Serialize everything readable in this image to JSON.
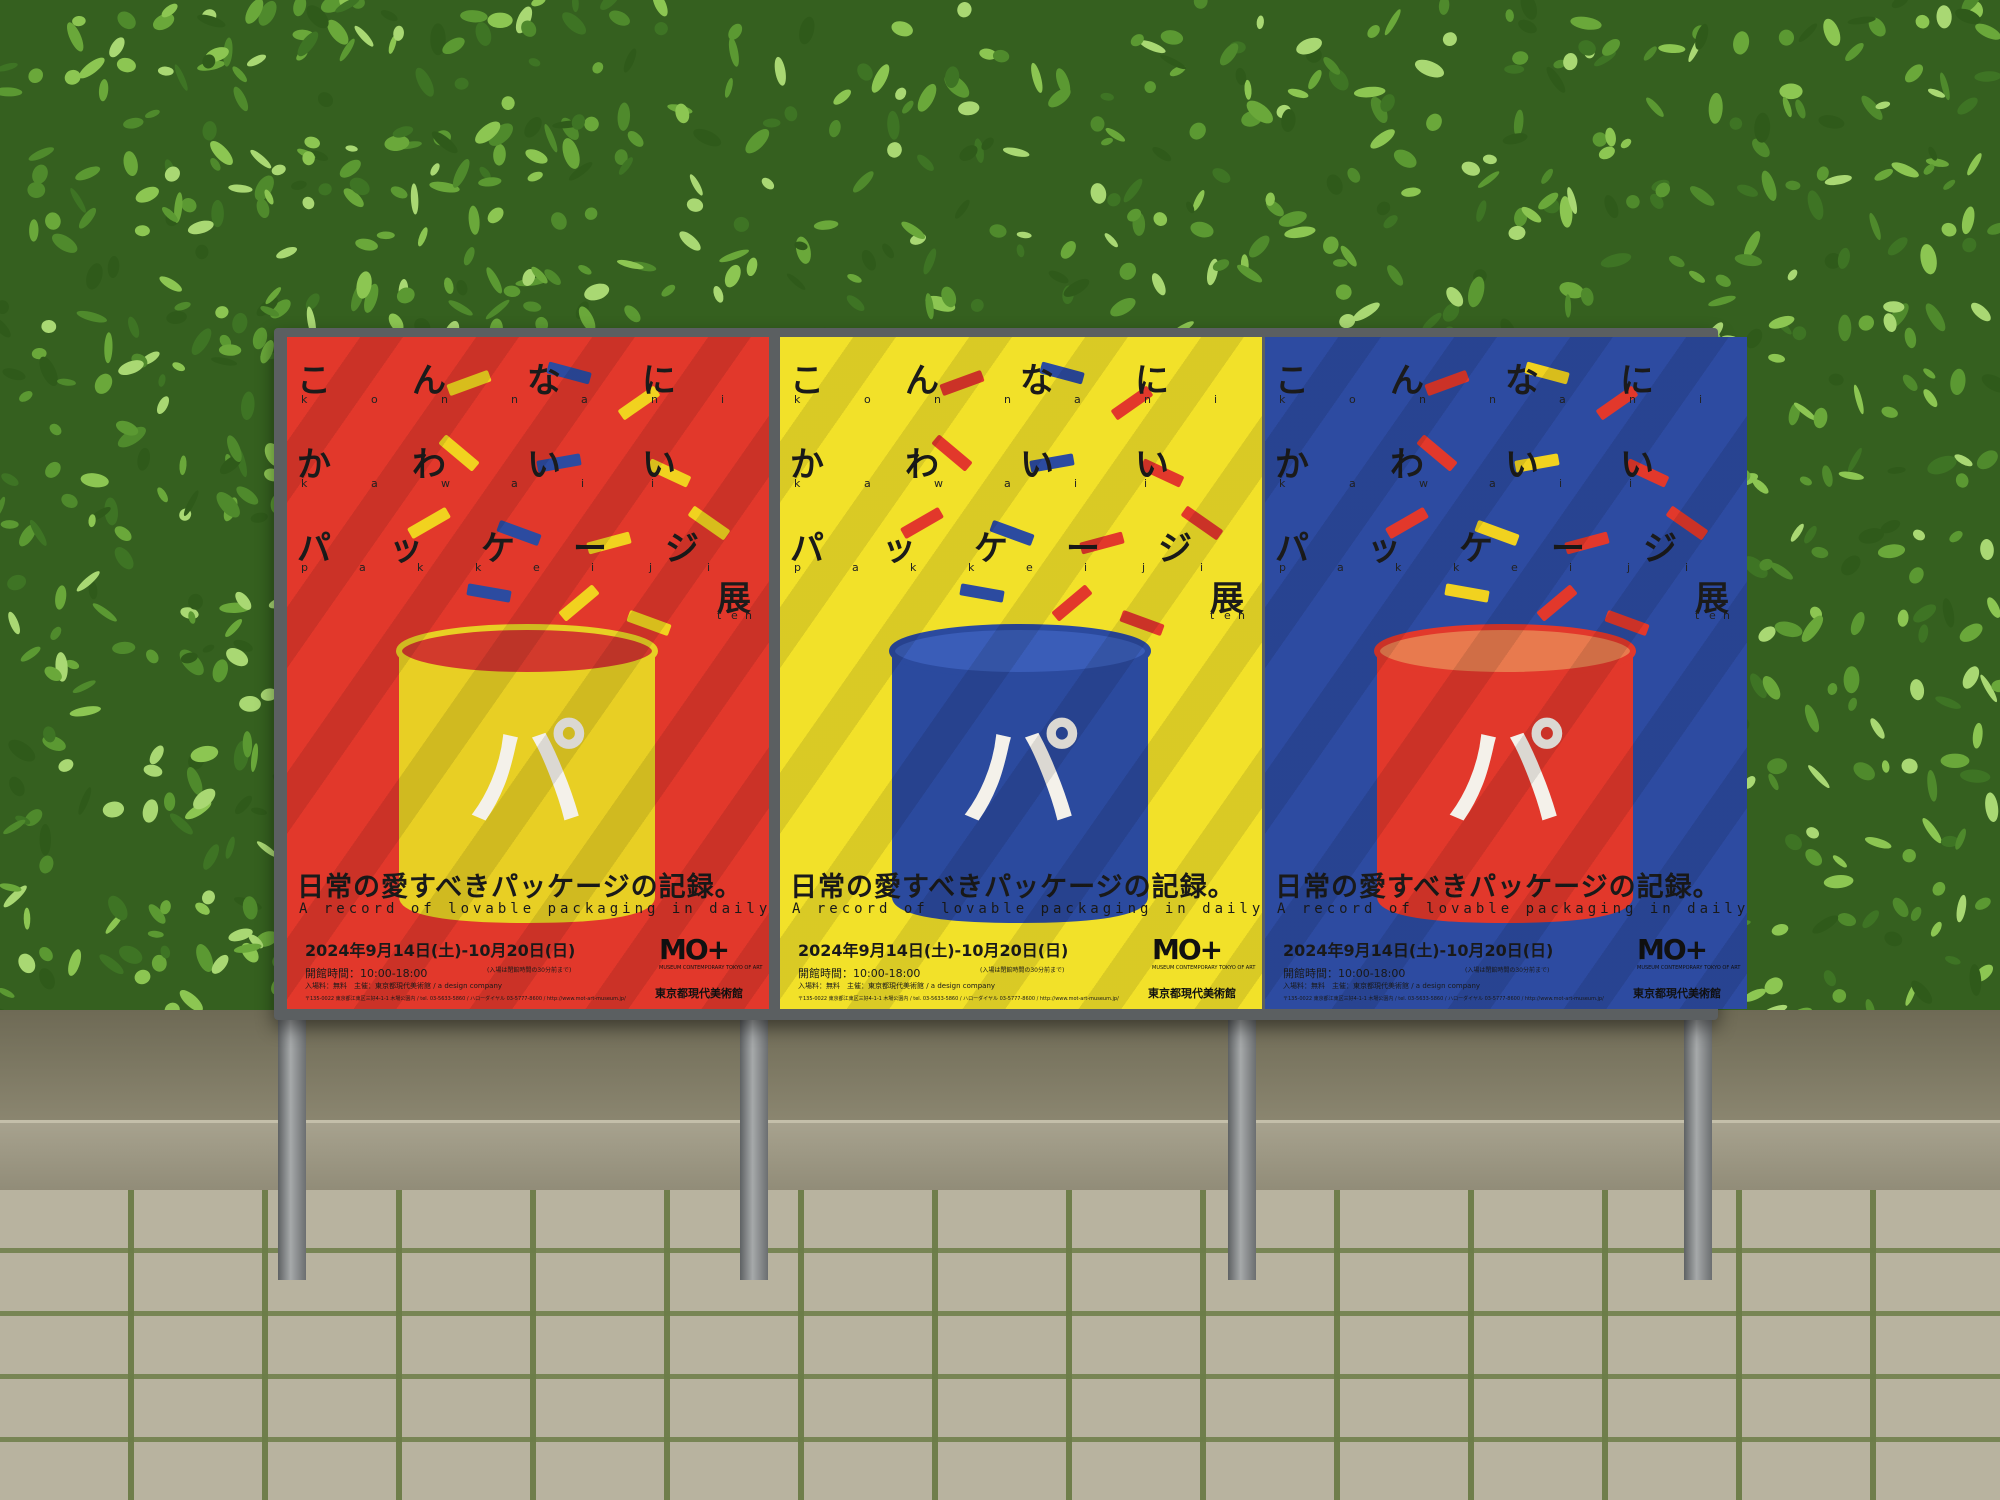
{
  "scene": {
    "description_colors": {
      "foliage": "#3f6e25",
      "frame": "#5b5f61"
    }
  },
  "poster_common": {
    "title_chars": [
      "こ",
      "ん",
      "な",
      "に",
      "か",
      "わ",
      "い",
      "い",
      "パ",
      "ッ",
      "ケ",
      "ー",
      "ジ",
      "展"
    ],
    "title_roman": [
      "k",
      "o",
      "n",
      "n",
      "a",
      "n",
      "i",
      "k",
      "a",
      "w",
      "a",
      "i",
      "i",
      "p",
      "a",
      "k",
      "k",
      "e",
      "i",
      "j",
      "i",
      "t",
      "e",
      "n"
    ],
    "can_char": "パ",
    "tagline_jp": "日常の愛すべきパッケージの記録。",
    "tagline_en": "A record of lovable packaging in daily life.",
    "date": "2024年9月14日(土)-10月20日(日)",
    "hours": "開館時間：10:00-18:00",
    "hours_note": "(入場は閉館時間の30分前まで)",
    "info": "入場料：無料　主催：東京都現代美術館 / a design company",
    "address": "〒135-0022 東京都江東区三好4-1-1 木場公園内 / tel. 03-5633-5860 / ハローダイヤル 03-5777-8600 / http://www.mot-art-museum.jp/",
    "logo_mark": "MO+",
    "logo_en": "MUSEUM CONTEMPORARY TOKYO OF ART",
    "logo_jp": "東京都現代美術館"
  },
  "posters": [
    {
      "bg": "#e2382b",
      "can": "#e8cf24",
      "can_top": "#d23a2c",
      "confetti": [
        "#f1d21f",
        "#2c4ba0",
        "#f1d21f"
      ]
    },
    {
      "bg": "#f2e129",
      "can": "#2b4a9e",
      "can_top": "#3a5db8",
      "confetti": [
        "#e2382b",
        "#2c4ba0",
        "#e2382b"
      ]
    },
    {
      "bg": "#2d4ba1",
      "can": "#e2382b",
      "can_top": "#e87a4e",
      "confetti": [
        "#e2382b",
        "#f1d21f",
        "#e2382b"
      ]
    }
  ]
}
